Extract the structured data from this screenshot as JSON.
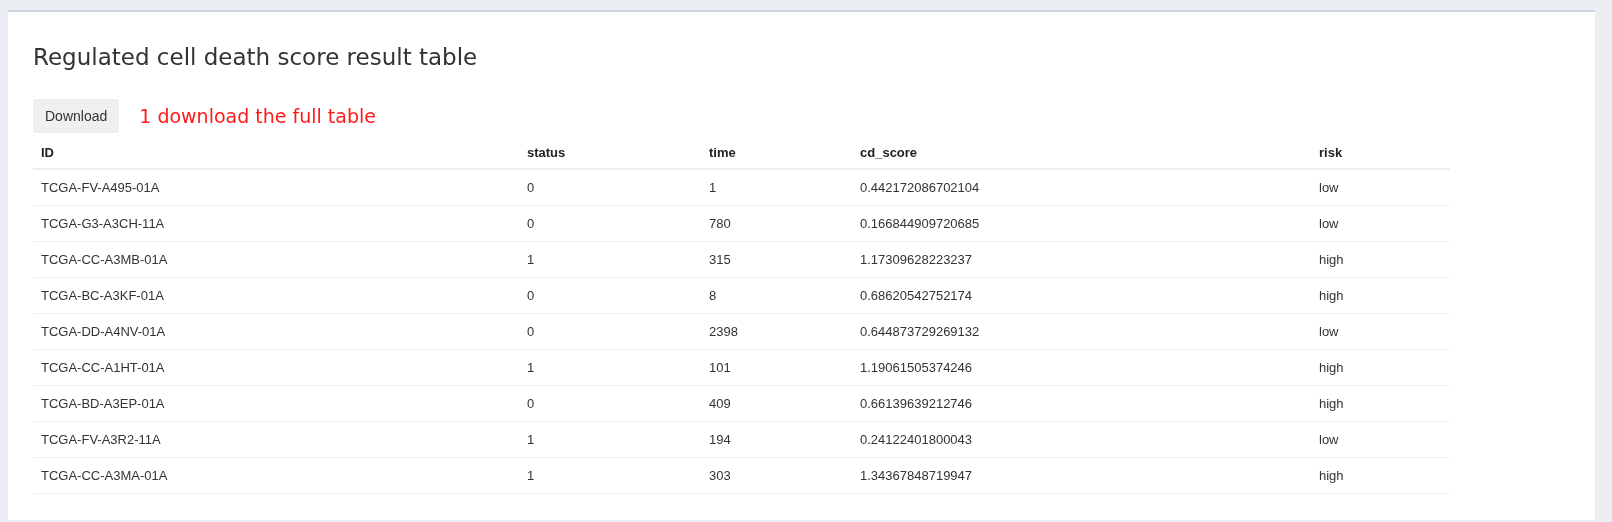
{
  "panel": {
    "title": "Regulated cell death score result table",
    "download_button": "Download",
    "note": "1 download the full table"
  },
  "table": {
    "columns": [
      "ID",
      "status",
      "time",
      "cd_score",
      "risk"
    ],
    "rows": [
      [
        "TCGA-FV-A495-01A",
        "0",
        "1",
        "0.442172086702104",
        "low"
      ],
      [
        "TCGA-G3-A3CH-11A",
        "0",
        "780",
        "0.166844909720685",
        "low"
      ],
      [
        "TCGA-CC-A3MB-01A",
        "1",
        "315",
        "1.17309628223237",
        "high"
      ],
      [
        "TCGA-BC-A3KF-01A",
        "0",
        "8",
        "0.68620542752174",
        "high"
      ],
      [
        "TCGA-DD-A4NV-01A",
        "0",
        "2398",
        "0.644873729269132",
        "low"
      ],
      [
        "TCGA-CC-A1HT-01A",
        "1",
        "101",
        "1.19061505374246",
        "high"
      ],
      [
        "TCGA-BD-A3EP-01A",
        "0",
        "409",
        "0.66139639212746",
        "high"
      ],
      [
        "TCGA-FV-A3R2-11A",
        "1",
        "194",
        "0.24122401800043",
        "low"
      ],
      [
        "TCGA-CC-A3MA-01A",
        "1",
        "303",
        "1.34367848719947",
        "high"
      ]
    ]
  }
}
